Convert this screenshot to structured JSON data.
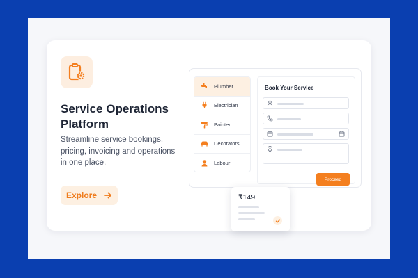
{
  "hero": {
    "title": "Service Operations Platform",
    "description": "Streamline service bookings, pricing, invoicing and operations in one place.",
    "explore_label": "Explore"
  },
  "services": [
    {
      "label": "Plumber",
      "icon": "faucet-icon"
    },
    {
      "label": "Electrician",
      "icon": "plug-icon"
    },
    {
      "label": "Painter",
      "icon": "paint-roller-icon"
    },
    {
      "label": "Decorators",
      "icon": "sofa-icon"
    },
    {
      "label": "Labour",
      "icon": "worker-icon"
    }
  ],
  "booking_form": {
    "title": "Book Your Service",
    "fields": [
      {
        "icon": "user-icon"
      },
      {
        "icon": "phone-icon"
      },
      {
        "icon": "calendar-icon"
      },
      {
        "icon": "location-pin-icon"
      }
    ],
    "proceed_label": "Proceed"
  },
  "price_card": {
    "price": "₹149"
  },
  "colors": {
    "accent": "#f47f1f",
    "accent_soft": "#fdf0e2",
    "page_background": "#0a3fb0",
    "canvas": "#f6f7fa",
    "text_dark": "#1d2434"
  }
}
